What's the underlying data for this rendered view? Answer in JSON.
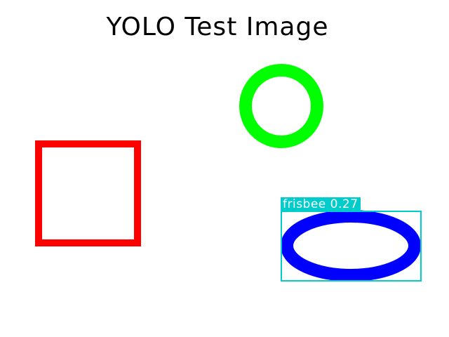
{
  "title": "YOLO Test Image",
  "shapes": {
    "square": {
      "kind": "square-outline",
      "color": "#ff0000"
    },
    "circle": {
      "kind": "circle-ring",
      "color": "#00ff00"
    },
    "ellipse": {
      "kind": "ellipse-ring",
      "color": "#0000ff"
    }
  },
  "detection": {
    "label": "frisbee 0.27",
    "class": "frisbee",
    "confidence": 0.27,
    "color": "#00cccc"
  }
}
